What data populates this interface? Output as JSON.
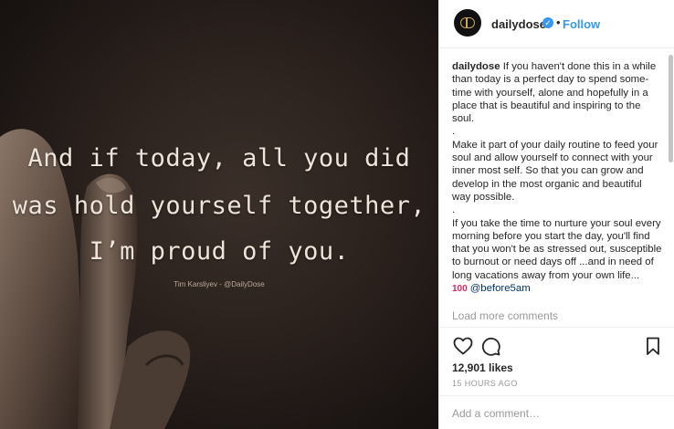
{
  "post": {
    "quote_lines": [
      "And if today, all you did",
      "was hold yourself together,",
      "I’m proud of you."
    ],
    "image_credit": "Tim Karsliyev - @DailyDose"
  },
  "header": {
    "username": "dailydose",
    "separator": "•",
    "follow_label": "Follow",
    "verified_icon": "verified-badge-icon"
  },
  "caption": {
    "username": "dailydose",
    "paragraph1": "If you haven't done this in a while than today is a perfect day to spend some-time with yourself, alone and hopefully in a place that is beautiful and inspiring to the soul.",
    "dot1": ".",
    "paragraph2": "Make it part of your daily routine to feed your soul and allow yourself to connect with your inner most self. So that you can grow and develop in the most organic and beautiful way possible.",
    "dot2": ".",
    "paragraph3": "If you take the time to nurture your soul every morning before you start the day, you'll find that you won't be as stressed out, susceptible to burnout or need days off ...and in need of long vacations away from your own life...",
    "emoji": "100",
    "mention": "@before5am"
  },
  "comments": {
    "load_more": "Load more comments"
  },
  "actions": {
    "like_icon": "heart-icon",
    "comment_icon": "comment-icon",
    "save_icon": "bookmark-icon"
  },
  "stats": {
    "likes": "12,901 likes",
    "time": "15 HOURS AGO"
  },
  "composer": {
    "placeholder": "Add a comment…"
  },
  "colors": {
    "link_blue": "#3897f0",
    "text": "#262626",
    "muted": "#999999",
    "badge_gold": "#c9a74d"
  }
}
